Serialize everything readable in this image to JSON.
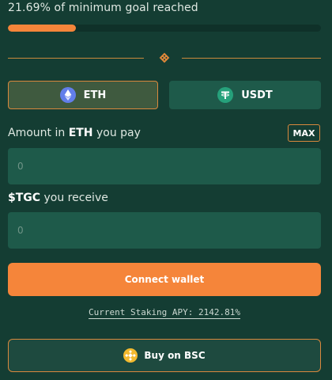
{
  "progress": {
    "label": "21.69% of minimum goal reached",
    "percent": 21.69,
    "fill_color": "#f5853a"
  },
  "divider": {
    "icon": "diamond-dots-icon"
  },
  "tokens": [
    {
      "symbol": "ETH",
      "icon": "ethereum-icon",
      "selected": true
    },
    {
      "symbol": "USDT",
      "icon": "tether-icon",
      "selected": false
    }
  ],
  "pay": {
    "label_prefix": "Amount in ",
    "label_token": "ETH",
    "label_suffix": " you pay",
    "max_label": "MAX",
    "placeholder": "0"
  },
  "receive": {
    "label_token": "$TGC",
    "label_suffix": " you receive",
    "placeholder": "0"
  },
  "connect_label": "Connect wallet",
  "apy_text": "Current Staking APY: 2142.81%",
  "bsc": {
    "label": "Buy on BSC",
    "icon": "bnb-icon"
  },
  "colors": {
    "background": "#143d33",
    "accent": "#f5853a",
    "border_accent": "#d9883d",
    "field": "#1e5a4a"
  }
}
